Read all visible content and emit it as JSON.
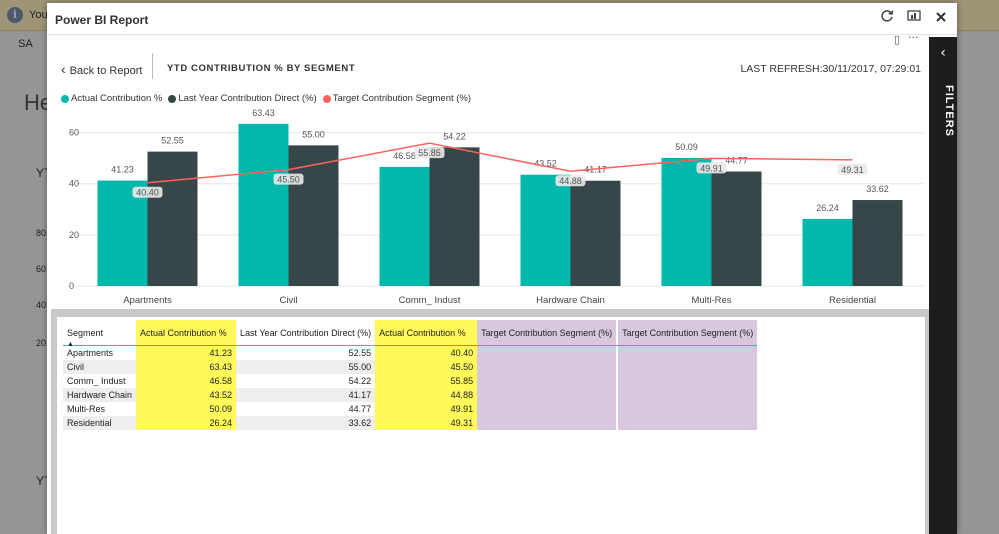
{
  "background": {
    "banner_text": "You",
    "save_text": "SA",
    "heading_text": "He",
    "yt1": "YT",
    "yt2": "YT",
    "axis": [
      "80",
      "60",
      "40",
      "20"
    ]
  },
  "modal": {
    "title": "Power BI Report",
    "icons": [
      "refresh-icon",
      "window-icon",
      "close-icon"
    ],
    "mic_icon": "mic-icon",
    "more_icon": "···"
  },
  "report": {
    "back_label": "Back to Report",
    "page_title": "YTD CONTRIBUTION % BY SEGMENT",
    "last_refresh": "LAST REFRESH:30/11/2017, 07:29:01",
    "filters_label": "FILTERS"
  },
  "colors": {
    "actual": "#01b8aa",
    "last_year": "#374649",
    "target": "#fd625e",
    "highlight_yellow": "#fff95a",
    "highlight_purple": "#d7c8dd"
  },
  "chart_data": {
    "type": "bar",
    "categories": [
      "Apartments",
      "Civil",
      "Comm_ Indust",
      "Hardware Chain",
      "Multi-Res",
      "Residential"
    ],
    "series": [
      {
        "name": "Actual Contribution %",
        "kind": "bar",
        "values": [
          41.23,
          63.43,
          46.58,
          43.52,
          50.09,
          26.24
        ]
      },
      {
        "name": "Last Year Contribution Direct (%)",
        "kind": "bar",
        "values": [
          52.55,
          55.0,
          54.22,
          41.17,
          44.77,
          33.62
        ]
      },
      {
        "name": "Target Contribution Segment (%)",
        "kind": "line",
        "values": [
          40.4,
          45.5,
          55.85,
          44.88,
          49.91,
          49.31
        ]
      }
    ],
    "yticks": [
      "0",
      "20",
      "40",
      "60"
    ],
    "ylim": [
      0,
      70
    ],
    "grid": true,
    "legend": "top-left"
  },
  "table": {
    "headers": [
      "Segment",
      "Actual Contribution %",
      "Last Year Contribution Direct (%)",
      "Actual Contribution %",
      "Target Contribution Segment (%)",
      "Target Contribution Segment (%)"
    ],
    "rows": [
      [
        "Apartments",
        "41.23",
        "52.55",
        "40.40",
        "",
        ""
      ],
      [
        "Civil",
        "63.43",
        "55.00",
        "45.50",
        "",
        ""
      ],
      [
        "Comm_ Indust",
        "46.58",
        "54.22",
        "55.85",
        "",
        ""
      ],
      [
        "Hardware Chain",
        "43.52",
        "41.17",
        "44.88",
        "",
        ""
      ],
      [
        "Multi-Res",
        "50.09",
        "44.77",
        "49.91",
        "",
        ""
      ],
      [
        "Residential",
        "26.24",
        "33.62",
        "49.31",
        "",
        ""
      ]
    ]
  }
}
